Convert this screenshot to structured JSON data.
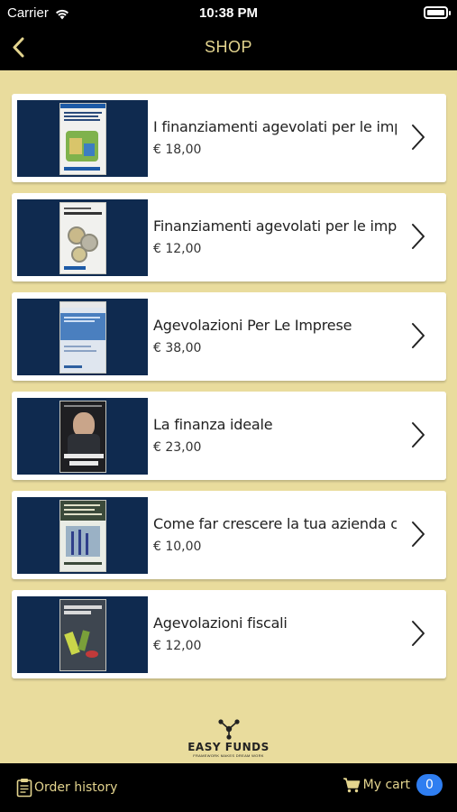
{
  "status_bar": {
    "carrier": "Carrier",
    "time": "10:38 PM"
  },
  "nav": {
    "title": "SHOP",
    "back_icon": "chevron-left-icon"
  },
  "products": [
    {
      "name": "I finanziamenti agevolati per le imp...",
      "price": "€ 18,00"
    },
    {
      "name": "Finanziamenti agevolati per le impr...",
      "price": "€ 12,00"
    },
    {
      "name": "Agevolazioni Per Le Imprese",
      "price": "€ 38,00"
    },
    {
      "name": "La finanza ideale",
      "price": "€ 23,00"
    },
    {
      "name": "Come far crescere la tua azienda c...",
      "price": "€ 10,00"
    },
    {
      "name": "Agevolazioni fiscali",
      "price": "€ 12,00"
    }
  ],
  "logo": {
    "name": "EASY FUNDS",
    "tagline": "FRAMEWORK MAKES DREAM WORK"
  },
  "tab_bar": {
    "order_history_label": "Order history",
    "cart_label": "My cart",
    "cart_count": "0"
  },
  "colors": {
    "background": "#e9dc9d",
    "bars": "#000000",
    "accent_text": "#e3d48e",
    "badge": "#2f7ef1",
    "thumb_background": "#0f2a4f"
  }
}
